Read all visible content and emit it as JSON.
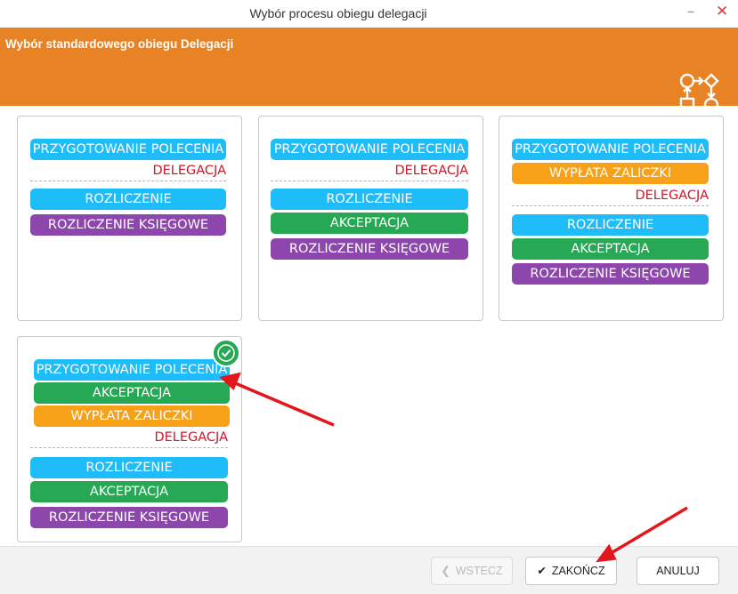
{
  "window": {
    "title": "Wybór procesu obiegu delegacji",
    "minimize_icon": "minimize-icon",
    "close_icon": "close-icon"
  },
  "header": {
    "title": "Wybór standardowego obiegu Delegacji",
    "icon": "workflow-icon"
  },
  "colors": {
    "banner": "#e88325",
    "blue": "#1ebdfa",
    "green": "#27a855",
    "orange": "#f6a117",
    "purple": "#8d46ac",
    "divider_text": "#c8192a"
  },
  "cards": [
    {
      "steps_before": [
        "PRZYGOTOWANIE POLECENIA"
      ],
      "divider": "DELEGACJA",
      "steps_after": [
        "ROZLICZENIE",
        "ROZLICZENIE KSIĘGOWE"
      ]
    },
    {
      "steps_before": [
        "PRZYGOTOWANIE POLECENIA"
      ],
      "divider": "DELEGACJA",
      "steps_after": [
        "ROZLICZENIE",
        "AKCEPTACJA",
        "ROZLICZENIE KSIĘGOWE"
      ]
    },
    {
      "steps_before": [
        "PRZYGOTOWANIE POLECENIA",
        "WYPŁATA ZALICZKI"
      ],
      "divider": "DELEGACJA",
      "steps_after": [
        "ROZLICZENIE",
        "AKCEPTACJA",
        "ROZLICZENIE KSIĘGOWE"
      ]
    },
    {
      "selected": true,
      "steps_before": [
        "PRZYGOTOWANIE POLECENIA",
        "AKCEPTACJA",
        "WYPŁATA ZALICZKI"
      ],
      "divider": "DELEGACJA",
      "steps_after": [
        "ROZLICZENIE",
        "AKCEPTACJA",
        "ROZLICZENIE KSIĘGOWE"
      ]
    }
  ],
  "footer": {
    "back_label": "WSTECZ",
    "finish_label": "ZAKOŃCZ",
    "cancel_label": "ANULUJ"
  }
}
